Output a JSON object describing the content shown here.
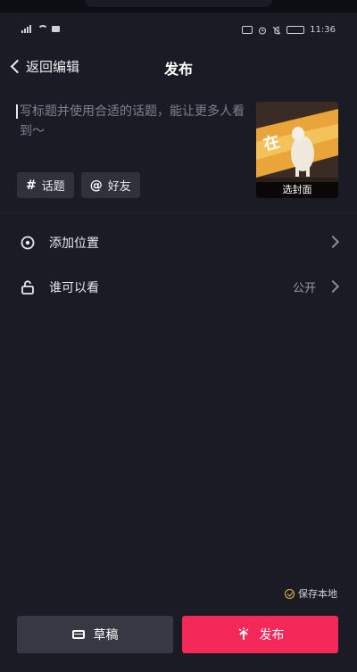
{
  "status_bar": {
    "time": "11:36"
  },
  "header": {
    "back_label": "返回编辑",
    "title": "发布"
  },
  "caption": {
    "placeholder": "写标题并使用合适的话题，能让更多人看到～",
    "value": ""
  },
  "cover": {
    "label": "选封面",
    "overlay_char": "在"
  },
  "chips": {
    "topic": {
      "icon": "hashtag-icon",
      "label": "话题"
    },
    "friend": {
      "icon": "at-icon",
      "label": "好友"
    }
  },
  "rows": {
    "location": {
      "icon": "location-pin-icon",
      "label": "添加位置"
    },
    "visibility": {
      "icon": "unlock-icon",
      "label": "谁可以看",
      "value": "公开"
    }
  },
  "save_local": {
    "label": "保存本地",
    "checked": true
  },
  "buttons": {
    "draft_label": "草稿",
    "publish_label": "发布"
  },
  "colors": {
    "background": "#1a1b24",
    "publish_accent": "#f5285a",
    "check_accent": "#e3c14b"
  }
}
